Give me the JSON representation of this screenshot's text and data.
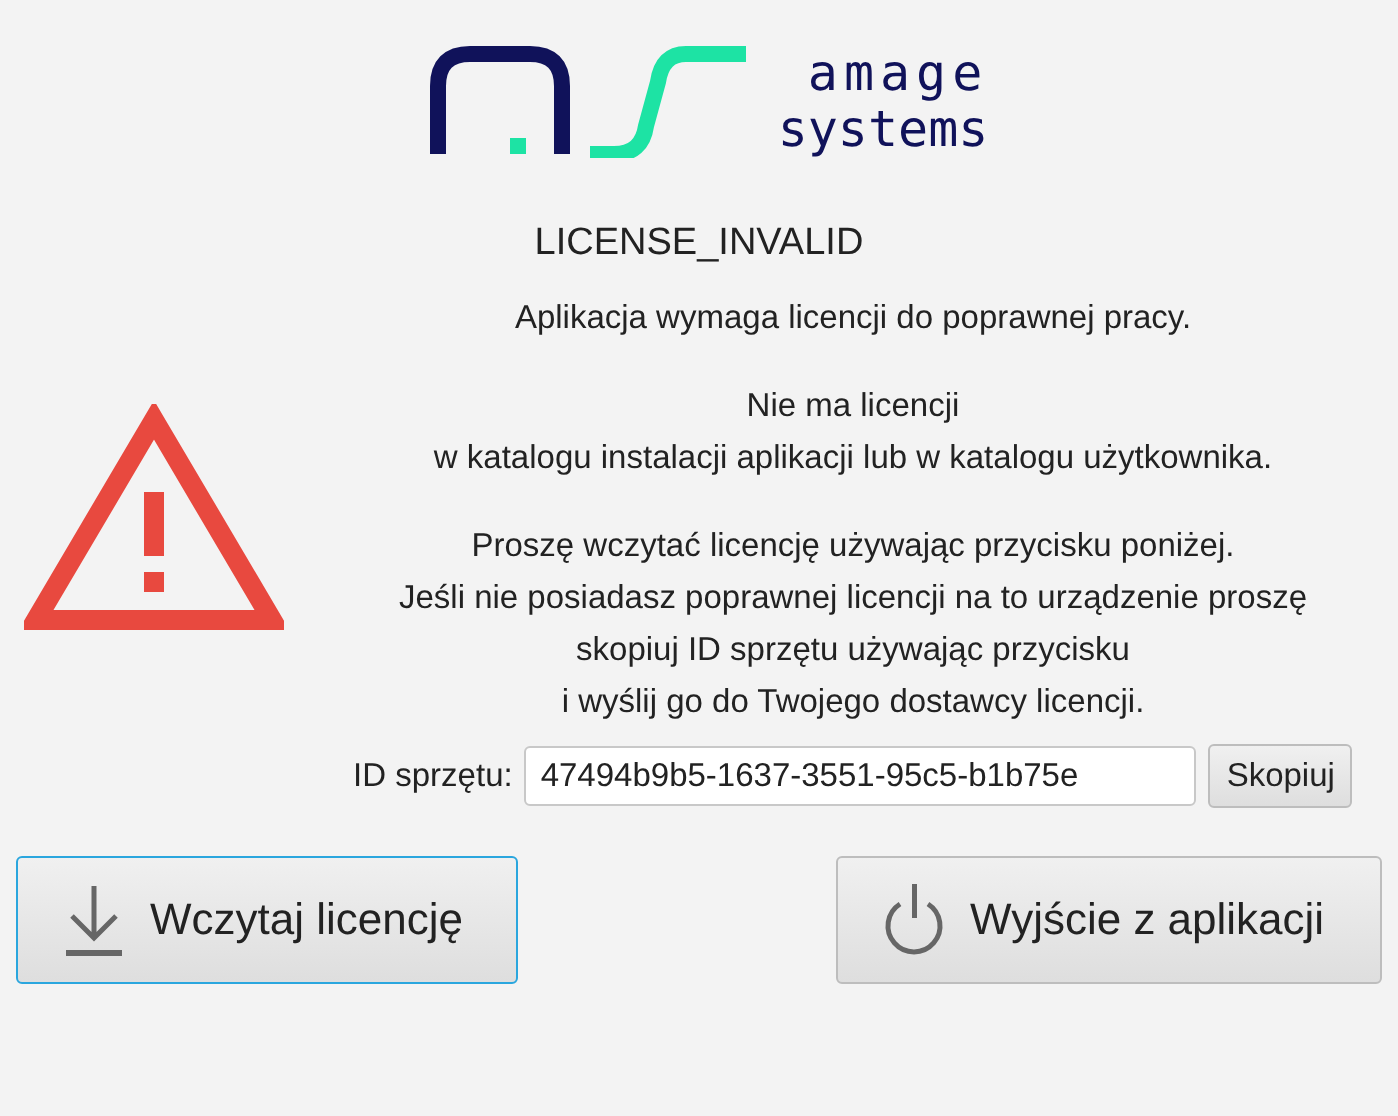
{
  "logo": {
    "line_1": "amage",
    "line_2": "systems"
  },
  "title": "LICENSE_INVALID",
  "paragraphs": [
    [
      "Aplikacja wymaga licencji do poprawnej pracy."
    ],
    [
      "Nie ma licencji",
      "w katalogu instalacji aplikacji lub w katalogu użytkownika."
    ],
    [
      "Proszę wczytać licencję używając przycisku poniżej.",
      "Jeśli nie posiadasz poprawnej licencji na to urządzenie proszę",
      "skopiuj ID sprzętu używając przycisku",
      "i wyślij go do Twojego dostawcy licencji."
    ]
  ],
  "hardware_id": {
    "label": "ID sprzętu:",
    "value": "47494b9b5-1637-3551-95c5-b1b75e",
    "copy_button": "Skopiuj"
  },
  "buttons": [
    {
      "kind": "load",
      "label": "Wczytaj licencję",
      "focused": true
    },
    {
      "kind": "exit",
      "label": "Wyjście z aplikacji",
      "focused": false
    }
  ]
}
